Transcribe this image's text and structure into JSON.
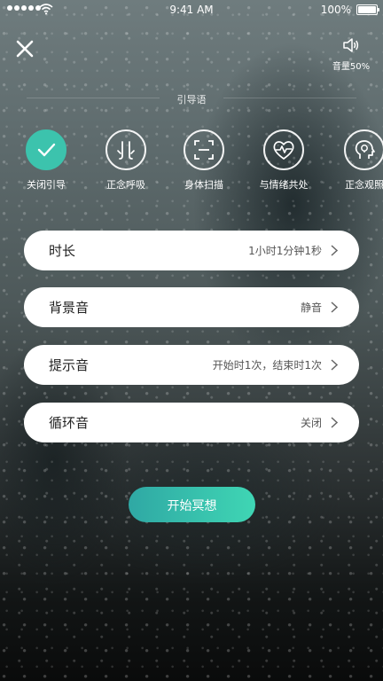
{
  "status_bar": {
    "time": "9:41 AM",
    "battery": "100%"
  },
  "header": {
    "volume_label": "音量50%"
  },
  "guidance": {
    "title": "引导语",
    "options": [
      {
        "label": "关闭引导",
        "icon": "check-icon",
        "selected": true
      },
      {
        "label": "正念呼吸",
        "icon": "breath-icon",
        "selected": false
      },
      {
        "label": "身体扫描",
        "icon": "scan-icon",
        "selected": false
      },
      {
        "label": "与情绪共处",
        "icon": "heart-pulse-icon",
        "selected": false
      },
      {
        "label": "正念观照",
        "icon": "head-bulb-icon",
        "selected": false
      }
    ]
  },
  "settings": [
    {
      "label": "时长",
      "value": "1小时1分钟1秒"
    },
    {
      "label": "背景音",
      "value": "静音"
    },
    {
      "label": "提示音",
      "value": "开始时1次，结束时1次"
    },
    {
      "label": "循环音",
      "value": "关闭"
    }
  ],
  "start_button": {
    "label": "开始冥想"
  },
  "colors": {
    "accent": "#3cc3ad",
    "gradient_start": "#2fa8a4",
    "gradient_end": "#3fd6b4"
  }
}
